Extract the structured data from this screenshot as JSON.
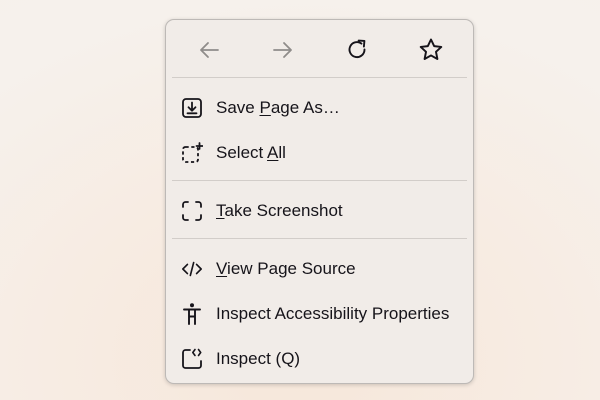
{
  "menu": {
    "nav": [
      {
        "name": "back",
        "icon": "arrow-left-icon",
        "enabled": false
      },
      {
        "name": "forward",
        "icon": "arrow-right-icon",
        "enabled": false
      },
      {
        "name": "reload",
        "icon": "reload-icon",
        "enabled": true
      },
      {
        "name": "bookmark",
        "icon": "star-icon",
        "enabled": true
      }
    ],
    "items": [
      {
        "icon": "save-download-icon",
        "pre": "Save ",
        "key": "P",
        "post": "age As…"
      },
      {
        "icon": "select-all-icon",
        "pre": "Select ",
        "key": "A",
        "post": "ll"
      },
      {
        "icon": "screenshot-icon",
        "pre": "",
        "key": "T",
        "post": "ake Screenshot"
      },
      {
        "icon": "code-icon",
        "pre": "",
        "key": "V",
        "post": "iew Page Source"
      },
      {
        "icon": "accessibility-icon",
        "pre": "Inspect Accessibility Properties",
        "key": "",
        "post": ""
      },
      {
        "icon": "inspect-icon",
        "pre": "Inspect (Q)",
        "key": "",
        "post": ""
      }
    ]
  },
  "colors": {
    "menu_bg": "#f1ece8",
    "text": "#16141a",
    "disabled_icon": "#8f8c8a",
    "separator": "#d2cdc9"
  }
}
